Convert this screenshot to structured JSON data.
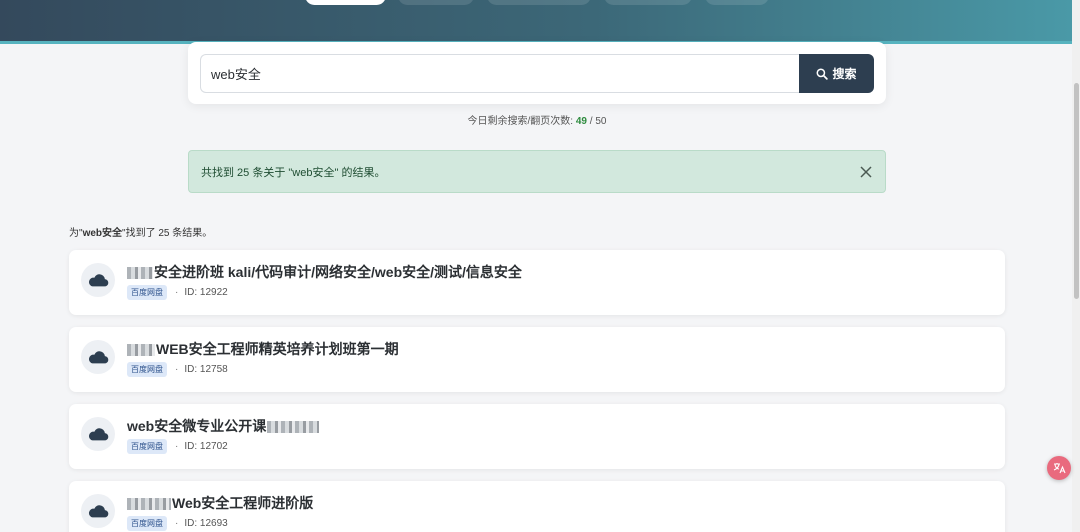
{
  "search": {
    "value": "web安全",
    "button_label": "搜索"
  },
  "quota": {
    "label": "今日剩余搜索/翻页次数: ",
    "used": "49",
    "separator": " / ",
    "total": "50"
  },
  "alert": {
    "message": "共找到 25 条关于 \"web安全\" 的结果。"
  },
  "summary": {
    "prefix": "为\"",
    "keyword": "web安全",
    "suffix": "\"找到了 25 条结果。"
  },
  "results": [
    {
      "title": "安全进阶班 kali/代码审计/网络安全/web安全/测试/信息安全",
      "tag": "百度网盘",
      "dot": "·",
      "id": "ID: 12922"
    },
    {
      "title": "WEB安全工程师精英培养计划班第一期",
      "tag": "百度网盘",
      "dot": "·",
      "id": "ID: 12758"
    },
    {
      "title": "web安全微专业公开课",
      "tag": "百度网盘",
      "dot": "·",
      "id": "ID: 12702"
    },
    {
      "title": "Web安全工程师进阶版",
      "tag": "百度网盘",
      "dot": "·",
      "id": "ID: 12693"
    }
  ],
  "icons": {
    "search": "search-icon",
    "close": "close-icon",
    "cloud": "cloud-icon",
    "translate": "translate-icon"
  },
  "colors": {
    "primary": "#2d3e50",
    "alert_bg": "#d2e8dd",
    "accent_green": "#2e8b3e",
    "tag_bg": "#dde8f8"
  }
}
